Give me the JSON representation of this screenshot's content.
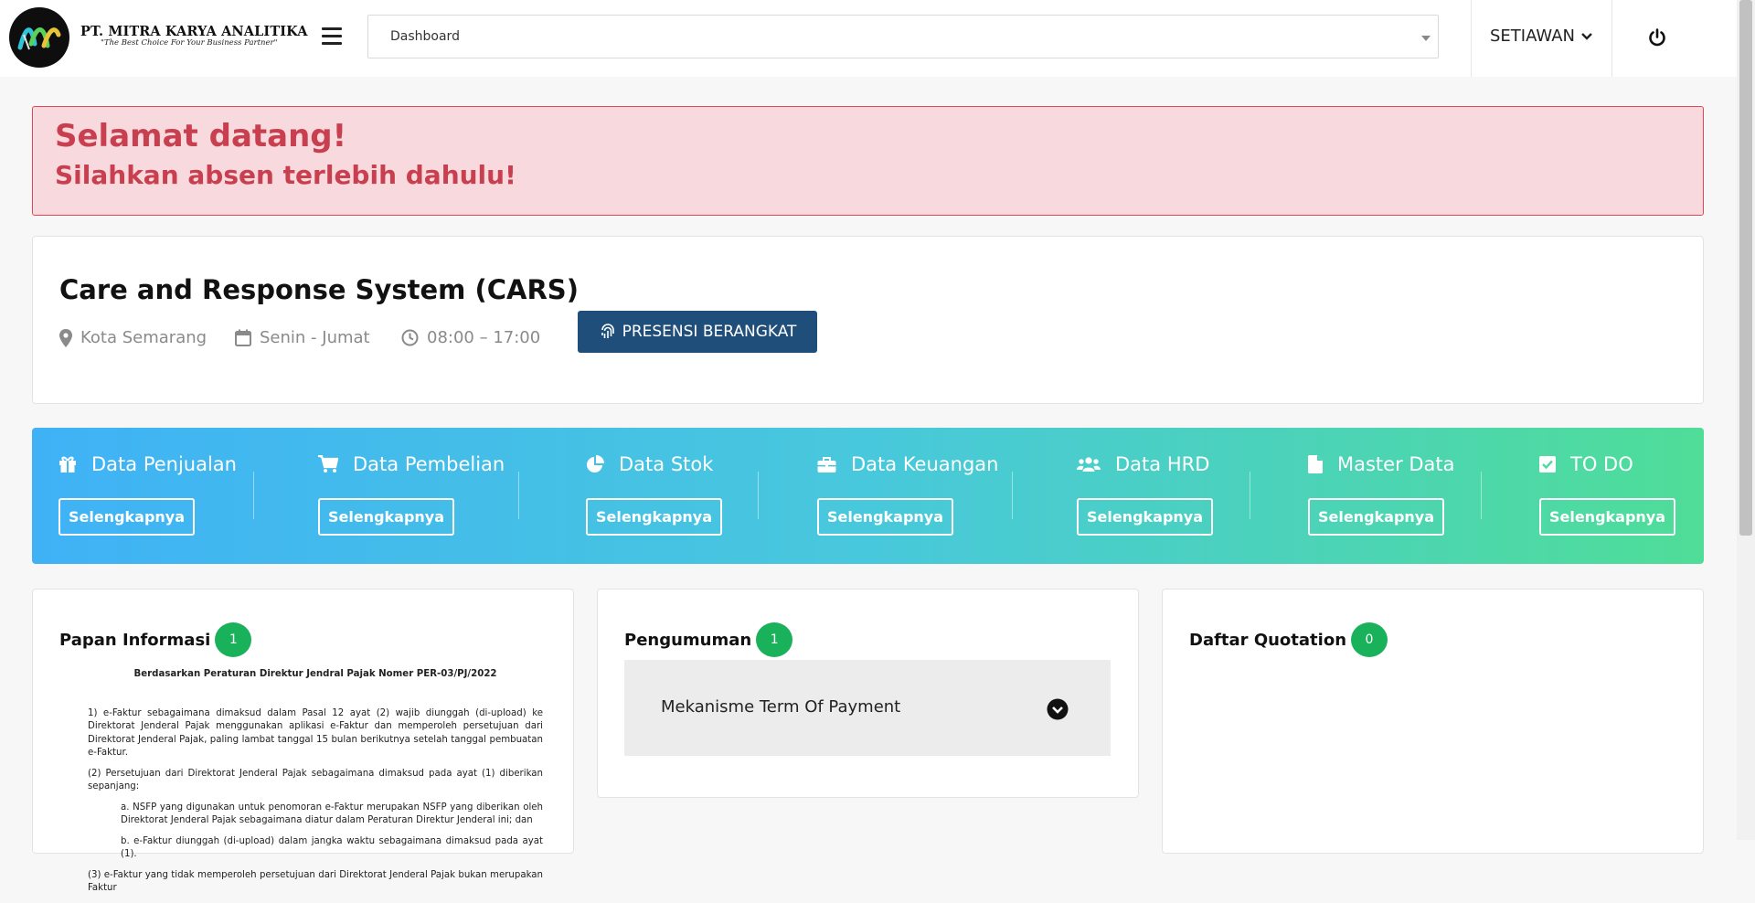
{
  "header": {
    "company_name": "PT. MITRA KARYA ANALITIKA",
    "tagline": "\"The Best Choice For Your Business Partner\"",
    "page_select_value": "Dashboard",
    "user_name": "SETIAWAN"
  },
  "alert": {
    "line1": "Selamat datang!",
    "line2": "Silahkan absen terlebih dahulu!"
  },
  "cars": {
    "title": "Care and Response System (CARS)",
    "location": "Kota Semarang",
    "days": "Senin - Jumat",
    "hours": "08:00 – 17:00",
    "presensi_button": "PRESENSI BERANGKAT"
  },
  "modules": [
    {
      "label": "Data Penjualan",
      "button": "Selengkapnya",
      "icon": "gift-icon"
    },
    {
      "label": "Data Pembelian",
      "button": "Selengkapnya",
      "icon": "cart-icon"
    },
    {
      "label": "Data Stok",
      "button": "Selengkapnya",
      "icon": "pie-chart-icon"
    },
    {
      "label": "Data Keuangan",
      "button": "Selengkapnya",
      "icon": "briefcase-icon"
    },
    {
      "label": "Data HRD",
      "button": "Selengkapnya",
      "icon": "users-icon"
    },
    {
      "label": "Master Data",
      "button": "Selengkapnya",
      "icon": "file-icon"
    },
    {
      "label": "TO DO",
      "button": "Selengkapnya",
      "icon": "checkbox-icon"
    }
  ],
  "papan_informasi": {
    "title": "Papan Informasi",
    "count": "1",
    "doc_heading": "Berdasarkan Peraturan Direktur Jendral Pajak Nomer PER-03/PJ/2022",
    "paragraphs": [
      "1) e-Faktur sebagaimana dimaksud dalam Pasal 12 ayat (2) wajib diunggah (di-upload) ke Direktorat Jenderal Pajak menggunakan aplikasi e-Faktur dan memperoleh persetujuan dari Direktorat Jenderal Pajak, paling lambat tanggal 15 bulan berikutnya setelah tanggal pembuatan e-Faktur.",
      "(2) Persetujuan dari Direktorat Jenderal Pajak sebagaimana dimaksud pada ayat (1) diberikan sepanjang:",
      "a. NSFP yang digunakan untuk penomoran e-Faktur merupakan NSFP yang diberikan oleh Direktorat Jenderal Pajak sebagaimana diatur dalam Peraturan Direktur Jenderal ini; dan",
      "b. e-Faktur diunggah (di-upload) dalam jangka waktu sebagaimana dimaksud pada ayat (1).",
      "(3) e-Faktur yang tidak memperoleh persetujuan dari Direktorat Jenderal Pajak bukan merupakan Faktur"
    ]
  },
  "pengumuman": {
    "title": "Pengumuman",
    "count": "1",
    "items": [
      "Mekanisme Term Of Payment"
    ]
  },
  "quotation": {
    "title": "Daftar Quotation",
    "count": "0"
  }
}
